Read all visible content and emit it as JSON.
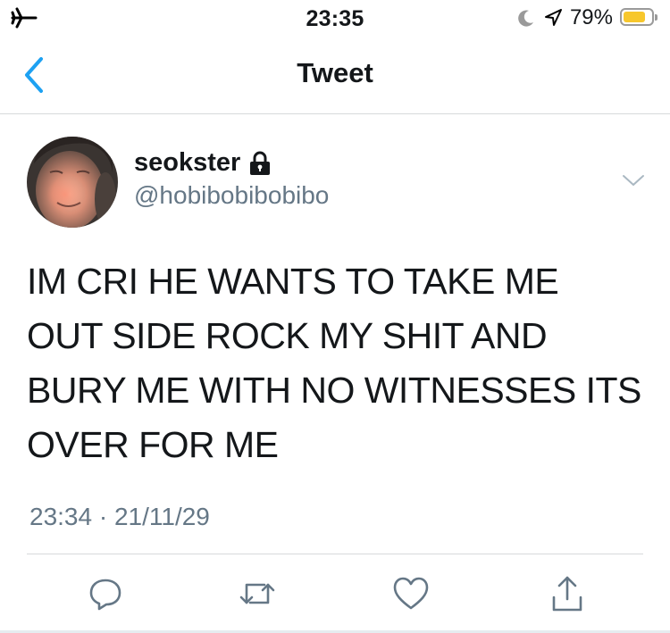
{
  "status_bar": {
    "time": "23:35",
    "battery_percent": "79%",
    "battery_level": 0.79,
    "battery_color": "#f7c72c",
    "icons": [
      "airplane-icon",
      "moon-icon",
      "location-icon",
      "battery-icon"
    ]
  },
  "nav": {
    "title": "Tweet",
    "back_icon": "chevron-left-icon",
    "accent": "#1da1f2"
  },
  "tweet": {
    "display_name": "seokster",
    "protected_icon": "lock-icon",
    "handle": "@hobibobibobibo",
    "text": "IM CRI HE WANTS TO TAKE ME OUT SIDE ROCK MY SHIT AND BURY ME WITH NO WITNESSES ITS OVER FOR ME",
    "timestamp": "23:34 · 21/11/29",
    "menu_icon": "chevron-down-icon"
  },
  "actions": [
    {
      "icon": "reply-icon"
    },
    {
      "icon": "retweet-icon"
    },
    {
      "icon": "like-icon"
    },
    {
      "icon": "share-icon"
    }
  ],
  "colors": {
    "text": "#14171a",
    "secondary": "#657786",
    "divider": "#d7d9db"
  }
}
